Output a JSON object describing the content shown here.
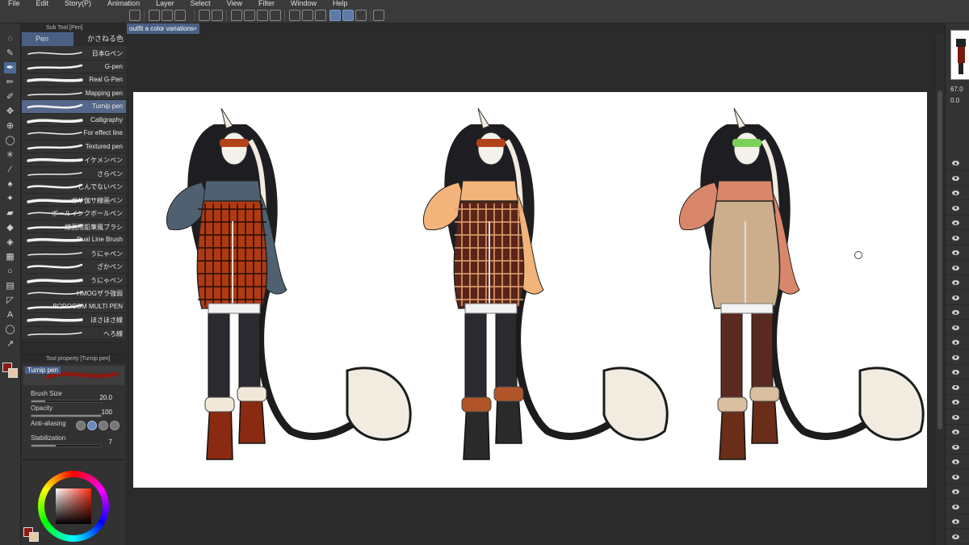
{
  "menu": [
    "File",
    "Edit",
    "Story(P)",
    "Animation",
    "Layer",
    "Select",
    "View",
    "Filter",
    "Window",
    "Help"
  ],
  "subtool": {
    "header": "Sub Tool [Pen]",
    "tabs": [
      "Pen",
      "かさねる色"
    ],
    "brushes": [
      "日本Gペン",
      "G-pen",
      "Real G-Pen",
      "Mapping pen",
      "Turnip pen",
      "Calligraphy",
      "For effect line",
      "Textured pen",
      "イケメンペン",
      "さらペン",
      "しんでないペン",
      "ガサ伽サ線画ペン",
      "ボールインクボールペン",
      "線画用鉛筆風ブラシ",
      "Dual Line Brush",
      "うにゃペン",
      "ざかペン",
      "うにゃペン",
      "HMOGザラ強弱",
      "BOROCOM MULTI PEN",
      "ほさほさ線",
      "へろ線"
    ],
    "active_index": 4
  },
  "tool_property": {
    "header": "Tool property [Turnip pen]",
    "preview_name": "Turnip pen",
    "brush_size_label": "Brush Size",
    "brush_size_value": "20.0",
    "brush_size_fraction": 0.2,
    "opacity_label": "Opacity",
    "opacity_value": "100",
    "opacity_fraction": 1.0,
    "antialias_label": "Anti-aliasing",
    "stabilization_label": "Stabilization",
    "stabilization_value": "7",
    "stabilization_fraction": 0.35
  },
  "document": {
    "tab_title": "outfit a color variations",
    "close_glyph": "×"
  },
  "navigator": {
    "zoom": "67.0",
    "rotation": "0.0"
  },
  "colors": {
    "main": "#8b1a14",
    "sub": "#e8c8a6",
    "accent": "#4a5f84"
  }
}
